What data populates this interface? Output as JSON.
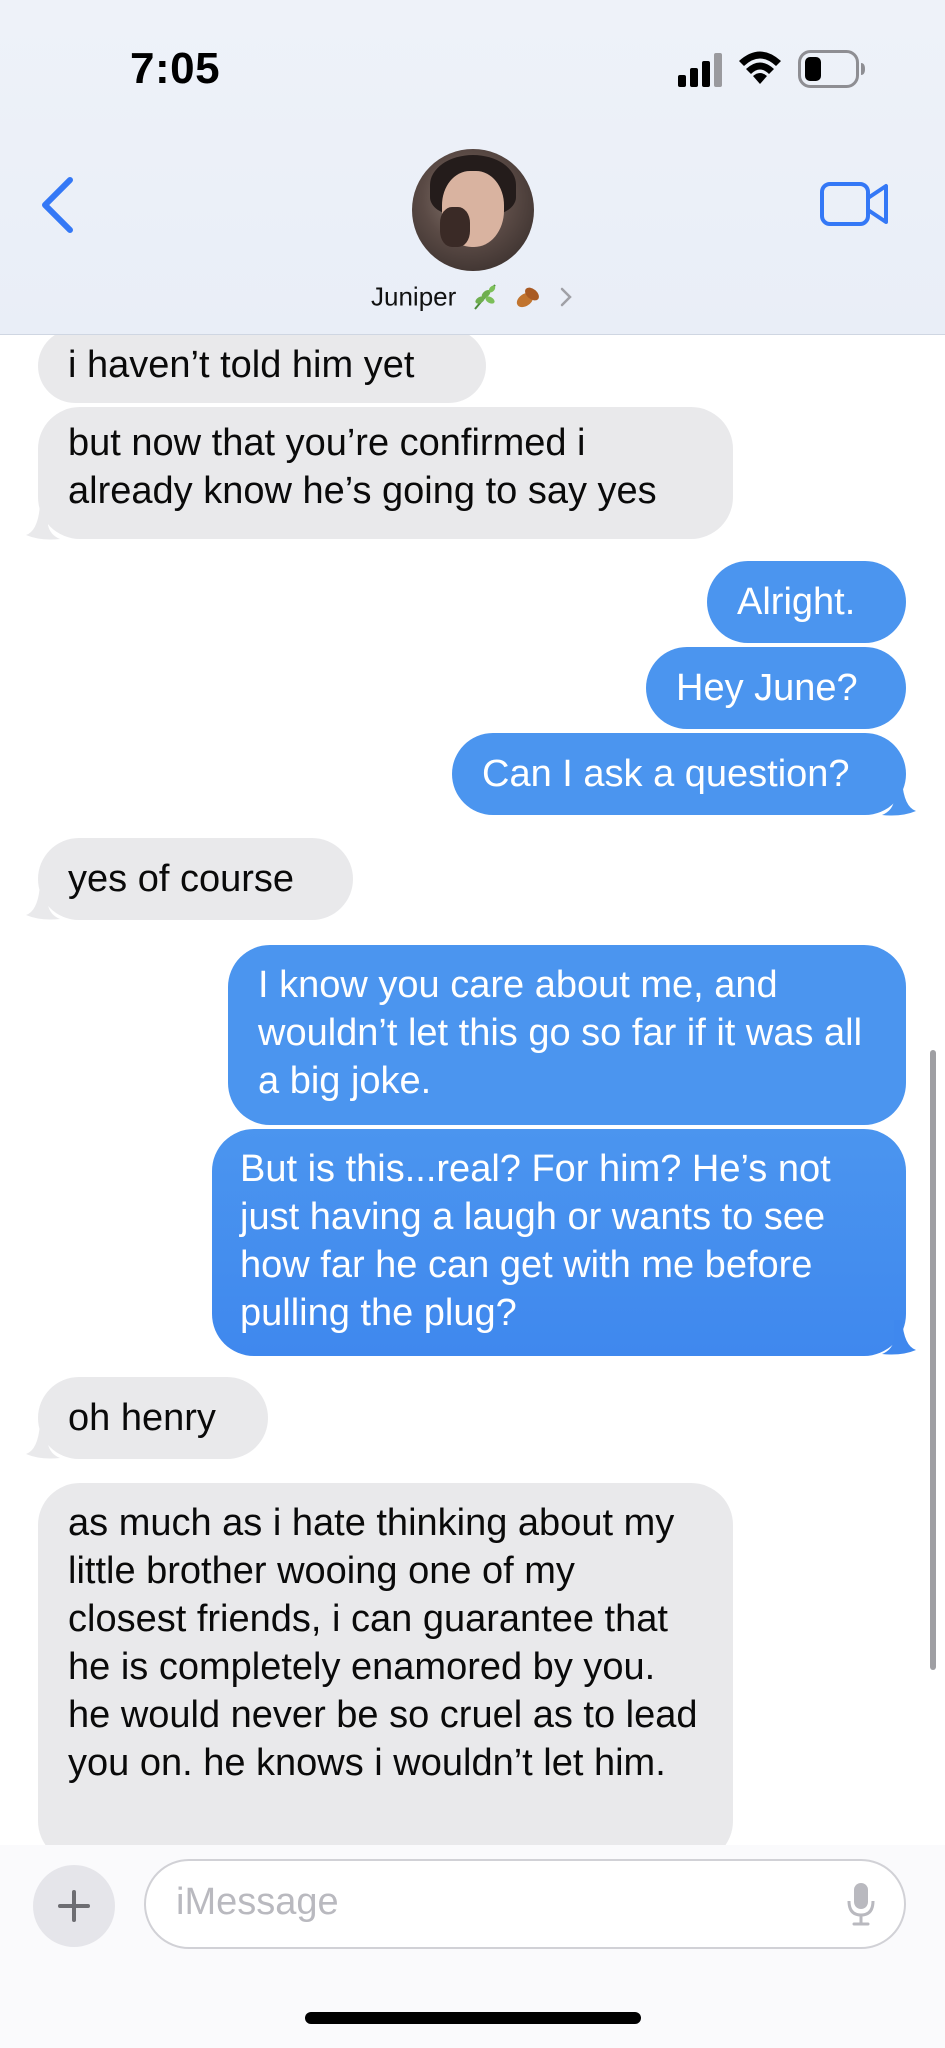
{
  "status_bar": {
    "time": "7:05"
  },
  "header": {
    "contact_name": "Juniper",
    "contact_emoji": [
      "herb-icon",
      "fallen-leaf-icon"
    ],
    "accent_color": "#3478f6"
  },
  "messages": [
    {
      "from": "them",
      "text": "i haven’t told him yet"
    },
    {
      "from": "them",
      "text": "but now that you’re confirmed i already know he’s going to say yes"
    },
    {
      "from": "me",
      "text": "Alright."
    },
    {
      "from": "me",
      "text": "Hey June?"
    },
    {
      "from": "me",
      "text": "Can I ask a question?"
    },
    {
      "from": "them",
      "text": "yes of course"
    },
    {
      "from": "me",
      "text": "I know you care about me, and wouldn’t let this go so far if it was all a big joke."
    },
    {
      "from": "me",
      "text": "But is this...real? For him? He’s not just having a laugh or wants to see how far he can get with me before pulling the plug?"
    },
    {
      "from": "them",
      "text": "oh henry"
    },
    {
      "from": "them",
      "text": "as much as i hate thinking about my little brother wooing one of my closest friends, i can guarantee that he is completely enamored by you. he would never be so cruel as to lead you on. he knows i wouldn’t let him."
    }
  ],
  "composer": {
    "placeholder": "iMessage"
  },
  "colors": {
    "incoming_bubble": "#e9e9eb",
    "outgoing_bubble": "#4b95ef"
  }
}
